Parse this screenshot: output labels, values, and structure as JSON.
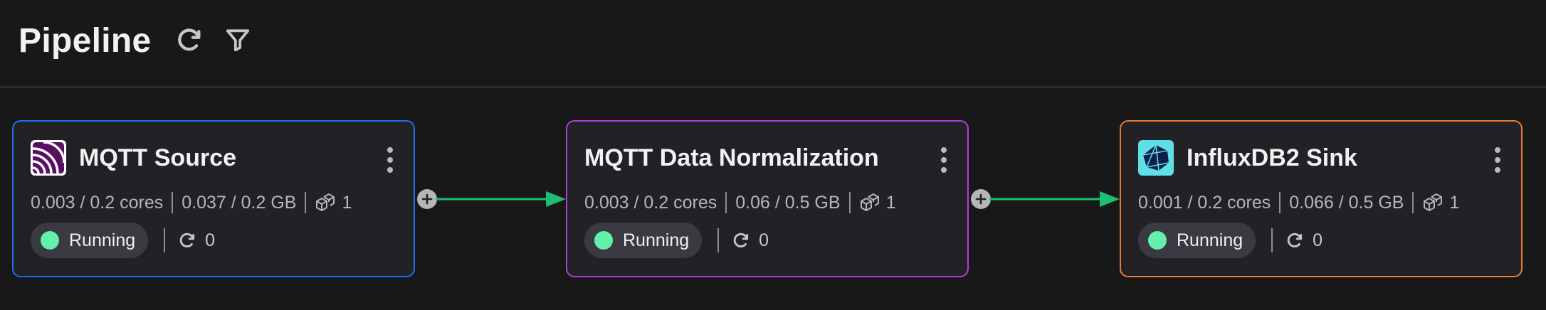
{
  "header": {
    "title": "Pipeline",
    "refresh_icon": "refresh-icon",
    "filter_icon": "filter-icon"
  },
  "colors": {
    "background": "#181818",
    "source_border": "#1e6ef0",
    "processor_border": "#b13fdc",
    "sink_border": "#e97a35",
    "edge": "#1fbd73",
    "status_running": "#63f0ab"
  },
  "nodes": [
    {
      "title": "MQTT Source",
      "logo": "mqtt-logo",
      "cpu": "0.003 / 0.2 cores",
      "memory": "0.037 / 0.2 GB",
      "replicas": "1",
      "status": "Running",
      "restarts": "0"
    },
    {
      "title": "MQTT Data Normalization",
      "logo": "",
      "cpu": "0.003 / 0.2 cores",
      "memory": "0.06 / 0.5 GB",
      "replicas": "1",
      "status": "Running",
      "restarts": "0"
    },
    {
      "title": "InfluxDB2 Sink",
      "logo": "influxdb-logo",
      "cpu": "0.001 / 0.2 cores",
      "memory": "0.066 / 0.5 GB",
      "replicas": "1",
      "status": "Running",
      "restarts": "0"
    }
  ]
}
